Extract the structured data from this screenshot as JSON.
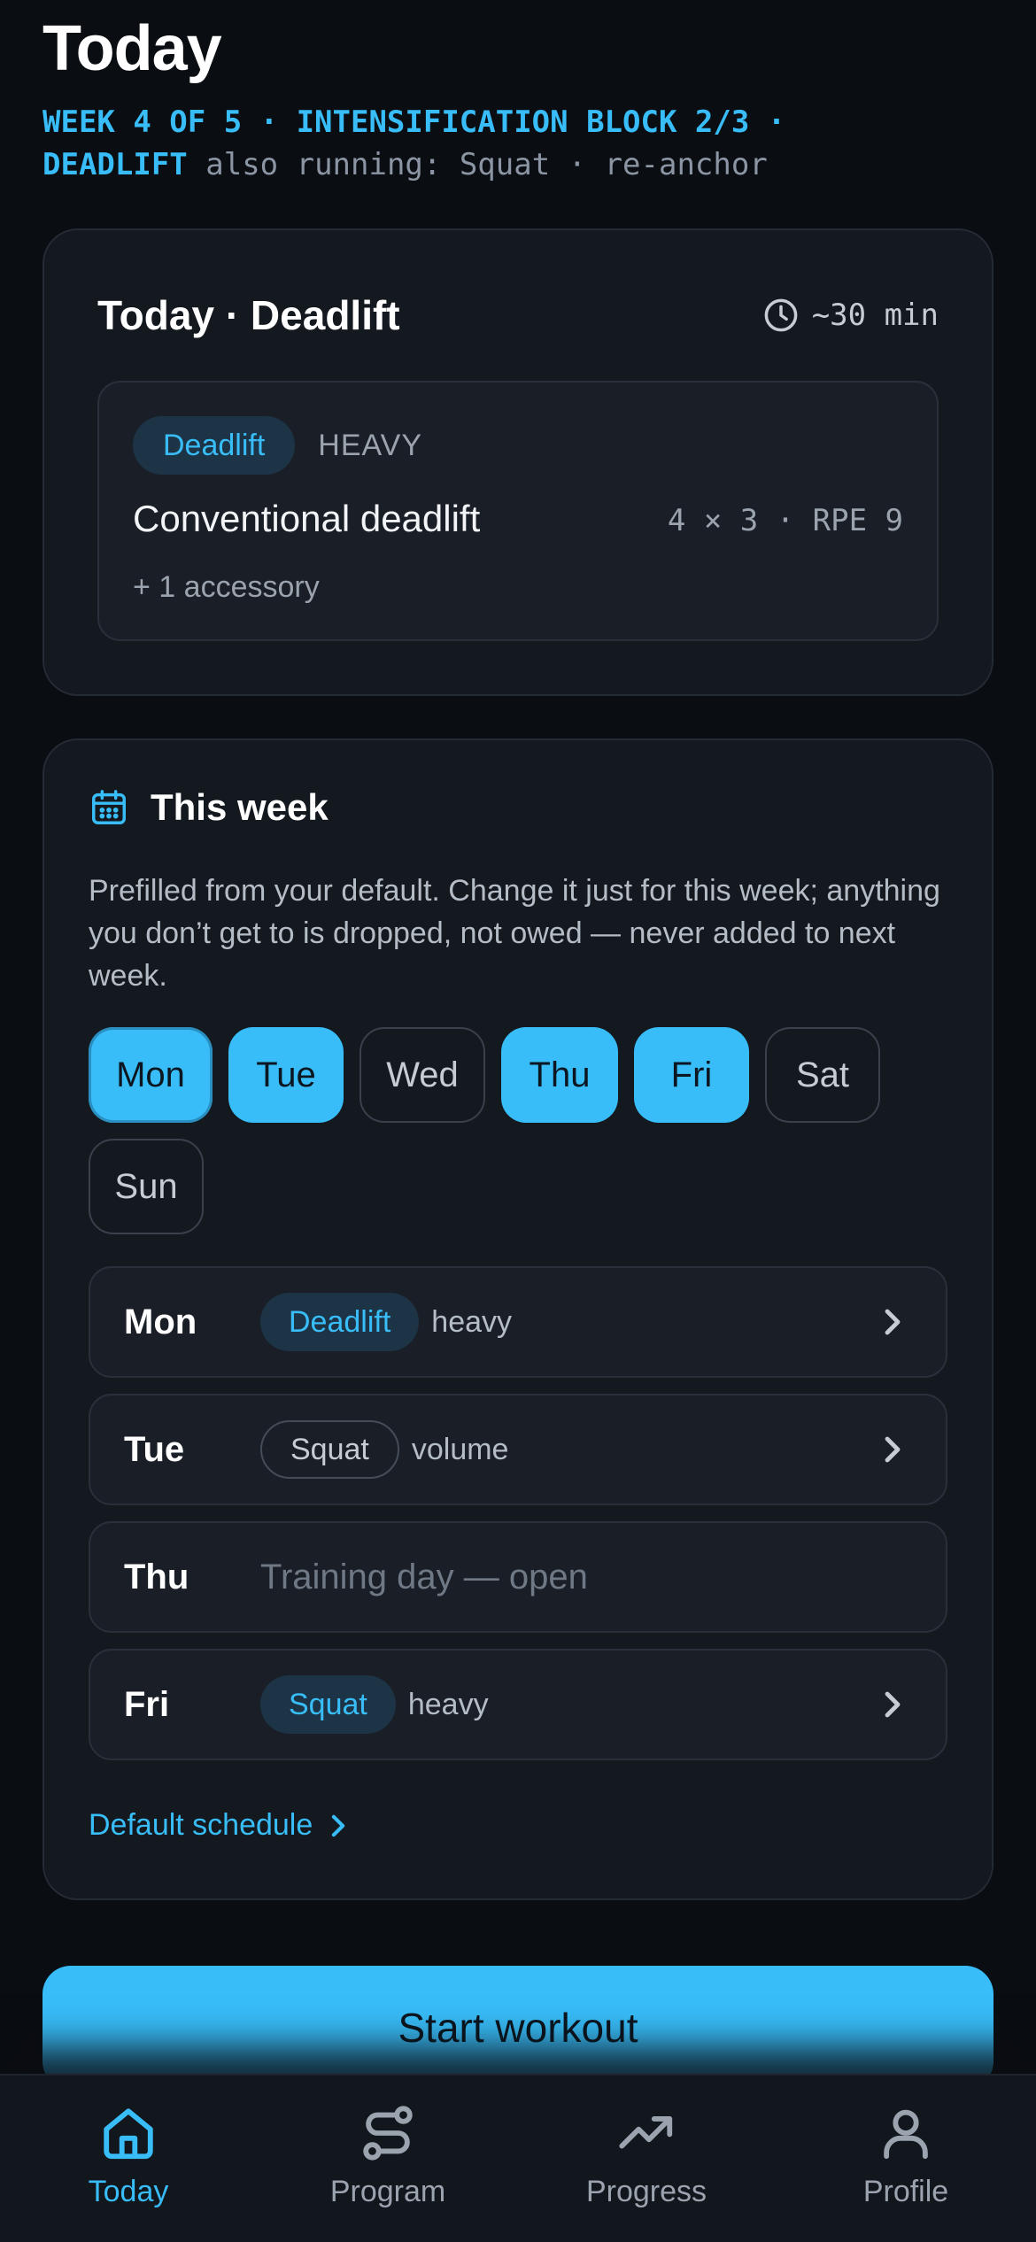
{
  "header": {
    "title": "Today",
    "block_line_accent_1": "WEEK 4 OF 5 · INTENSIFICATION BLOCK 2/3 ·",
    "block_line_accent_2": "DEADLIFT",
    "block_line_muted": "also running: Squat · re-anchor"
  },
  "today_card": {
    "title": "Today · Deadlift",
    "duration": "~30 min",
    "duration_icon": "clock-icon",
    "lift_tag": "Deadlift",
    "intensity": "HEAVY",
    "exercise_name": "Conventional deadlift",
    "scheme": "4 × 3 · RPE 9",
    "extra": "+ 1 accessory"
  },
  "week_card": {
    "title": "This week",
    "icon": "calendar-icon",
    "description": "Prefilled from your default. Change it just for this week; anything you don’t get to is dropped, not owed — never added to next week.",
    "days": [
      {
        "label": "Mon",
        "selected": true
      },
      {
        "label": "Tue",
        "selected": true
      },
      {
        "label": "Wed",
        "selected": false
      },
      {
        "label": "Thu",
        "selected": true
      },
      {
        "label": "Fri",
        "selected": true
      },
      {
        "label": "Sat",
        "selected": false
      },
      {
        "label": "Sun",
        "selected": false
      }
    ],
    "schedule": [
      {
        "day": "Mon",
        "lift": "Deadlift",
        "kind": "heavy"
      },
      {
        "day": "Tue",
        "lift": "Squat",
        "kind": "volume"
      },
      {
        "day": "Thu",
        "open_text": "Training day — open"
      },
      {
        "day": "Fri",
        "lift": "Squat",
        "kind": "heavy"
      }
    ],
    "default_link": "Default schedule"
  },
  "start_button": "Start workout",
  "tabs": [
    {
      "label": "Today",
      "icon": "home-icon",
      "active": true
    },
    {
      "label": "Program",
      "icon": "route-icon",
      "active": false
    },
    {
      "label": "Progress",
      "icon": "trend-up-icon",
      "active": false
    },
    {
      "label": "Profile",
      "icon": "user-icon",
      "active": false
    }
  ],
  "colors": {
    "accent": "#38bdf8",
    "background": "#0a0d12",
    "card": "#14181f"
  }
}
